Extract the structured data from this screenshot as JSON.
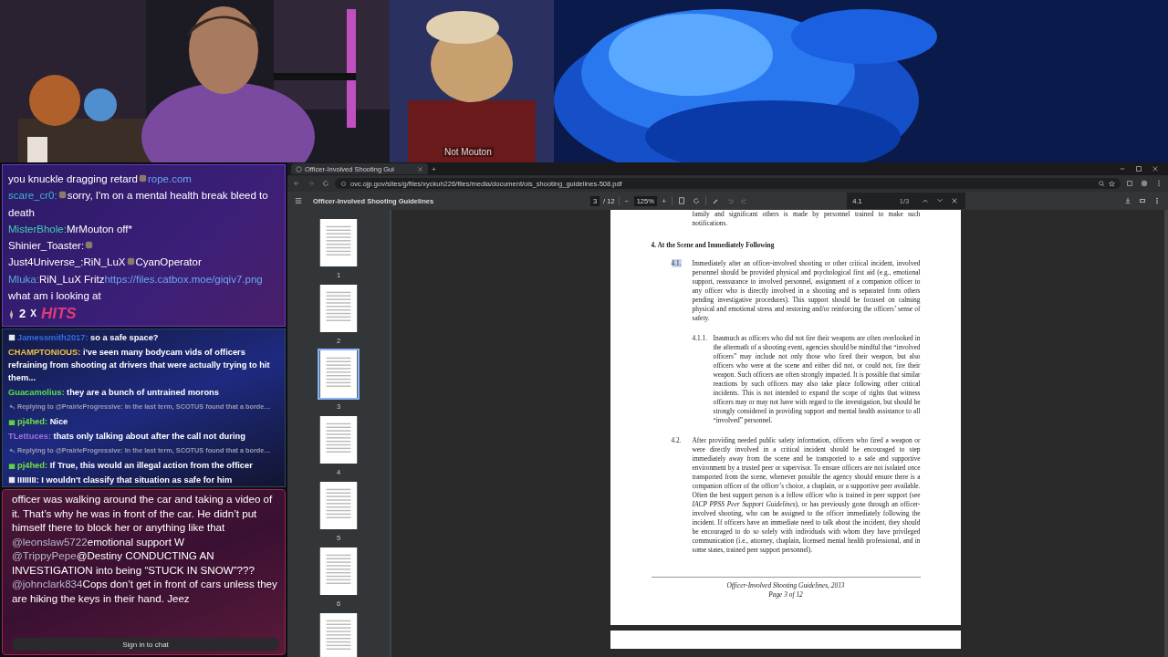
{
  "stream_overlay": {
    "caption": "Not Mouton"
  },
  "chat_top": {
    "messages": [
      {
        "parts": [
          {
            "kind": "text",
            "text": "you knuckle dragging retard"
          },
          {
            "kind": "emote"
          },
          {
            "kind": "link",
            "text": "rope.com"
          }
        ]
      },
      {
        "user": "scare_cr0:",
        "color": "#3fb8d0",
        "parts": [
          {
            "kind": "emote"
          },
          {
            "kind": "text",
            "text": "sorry, I'm on a mental health break bleed to death"
          }
        ]
      },
      {
        "user": "MisterBhole:",
        "color": "#3fd0b8",
        "parts": [
          {
            "kind": "text",
            "text": "MrMouton off*"
          }
        ]
      },
      {
        "user": "Shinier_Toaster:",
        "color": "#ffffff",
        "parts": [
          {
            "kind": "emote"
          }
        ]
      },
      {
        "user": "Just4Universe_:",
        "color": "#ffffff",
        "parts": [
          {
            "kind": "text",
            "text": "RiN_LuX"
          },
          {
            "kind": "emote"
          },
          {
            "kind": "text",
            "text": "CyanOperator"
          }
        ]
      },
      {
        "user": "Mluka:",
        "color": "#5aa8e0",
        "parts": [
          {
            "kind": "text",
            "text": "RiN_LuX Fritz"
          },
          {
            "kind": "link",
            "text": "https://files.catbox.moe/giqiv7.png"
          }
        ]
      },
      {
        "parts": [
          {
            "kind": "text",
            "text": "what am i looking at"
          }
        ]
      }
    ],
    "hits": {
      "count": "2",
      "times": "X",
      "label": "HITS"
    }
  },
  "chat_middle": {
    "messages": [
      {
        "kind": "message",
        "badge": {
          "kind": "emote"
        },
        "user": "Jamessmith2017:",
        "color": "#2f6fe0",
        "text": "so a safe space?"
      },
      {
        "kind": "message",
        "user": "CHAMPTONIOUS:",
        "color": "#f0c040",
        "text": "i've seen many bodycam vids of officers refraining from shooting at drivers that were actually trying to hit them..."
      },
      {
        "kind": "message",
        "user": "Guacamolius:",
        "color": "#58e050",
        "text": "they are a bunch of untrained morons"
      },
      {
        "kind": "reply",
        "text": "Replying to @PrairieProgressive: In the last term, SCOTUS found that a borde…"
      },
      {
        "kind": "message",
        "badge": {
          "kind": "gift"
        },
        "user": "pj4hed:",
        "color": "#70e040",
        "text": "Nice"
      },
      {
        "kind": "message",
        "user": "TLettuces:",
        "color": "#a070e8",
        "text": "thats only talking about after the call not during"
      },
      {
        "kind": "reply",
        "text": "Replying to @PrairieProgressive: In the last term, SCOTUS found that a borde…"
      },
      {
        "kind": "message",
        "badge": {
          "kind": "gift"
        },
        "user": "pj4hed:",
        "color": "#70e040",
        "text": "If True, this would an illegal action from the officer"
      },
      {
        "kind": "message",
        "badge": {
          "kind": "emote"
        },
        "user": "IIIIIIII:",
        "color": "#ffffff",
        "text": "I wouldn't classify that situation as safe for him"
      }
    ]
  },
  "chat_bottom": {
    "messages": [
      {
        "text": "officer was walking around the car and taking a video of it. That’s why he was in front of the car. He didn’t put himself there to block her or anything like that"
      },
      {
        "user": "@leonslaw5722",
        "text": "emotional support W"
      },
      {
        "user": "@TrippyPepe",
        "text": "@Destiny CONDUCTING AN INVESTIGATION into being “STUCK IN SNOW”???"
      },
      {
        "user": "@johnclark834",
        "text": "Cops don’t get in front of cars unless they are hiking the keys in their hand. Jeez"
      }
    ],
    "sign_in_button": "Sign in to chat"
  },
  "browser": {
    "tabs": [
      {
        "title": "Officer-Involved Shooting Gui",
        "selected": true
      }
    ],
    "new_tab": "+",
    "address": "ovc.ojp.gov/sites/g/files/xyckuh226/files/media/document/ois_shooting_guidelines-508.pdf",
    "pdf_toolbar": {
      "title": "Officer-Involved Shooting Guidelines",
      "page": "3",
      "page_total": "/ 12",
      "zoom_out": "−",
      "zoom": "125%",
      "zoom_in": "+"
    },
    "find": {
      "value": "4.1",
      "count": "1/3"
    }
  },
  "thumbnails": [
    {
      "label": "1",
      "selected": false
    },
    {
      "label": "2",
      "selected": false
    },
    {
      "label": "3",
      "selected": true
    },
    {
      "label": "4",
      "selected": false
    },
    {
      "label": "5",
      "selected": false
    },
    {
      "label": "6",
      "selected": false
    },
    {
      "selected": false
    }
  ],
  "pdf_page": {
    "blocks": [
      {
        "kind": "paragraph",
        "text": "family and significant others is made by personnel trained to make such notifications."
      },
      {
        "kind": "heading",
        "text": "4. At the Scene and Immediately Following"
      },
      {
        "kind": "item",
        "number": "4.1.",
        "highlighted": true,
        "text": "Immediately after an officer-involved shooting or other critical incident, involved personnel should be provided physical and psychological first aid (e.g., emotional support, reassurance to involved personnel, assignment of a companion officer to any officer who is directly involved in a shooting and is separated from others pending investigative procedures). This support should be focused on calming physical and emotional stress and restoring and/or reinforcing the officers’ sense of safety."
      },
      {
        "kind": "subitem",
        "number": "4.1.1.",
        "highlighted": false,
        "text": "Inasmuch as officers who did not fire their weapons are often overlooked in the aftermath of a shooting event, agencies should be mindful that “involved officers” may include not only those who fired their weapon, but also officers who were at the scene and either did not, or could not, fire their weapon.  Such officers are often strongly impacted. It is possible that similar reactions by such officers may also take place following other critical incidents.  This is not intended to expand the scope of rights that witness officers may or may not have with regard to the investigation, but should be strongly considered in providing support and mental health assistance to all “involved” personnel."
      },
      {
        "kind": "item",
        "number": "4.2.",
        "highlighted": false,
        "text": "After providing needed public safety information, officers who fired a weapon or were directly involved in a critical incident should be encouraged to step immediately away from the scene and be transported to a safe and supportive environment by a trusted peer or supervisor. To ensure officers are not isolated once transported from the scene, whenever possible the agency should ensure there is a companion officer of the officer’s choice, a chaplain, or a supportive peer available.  Often the best support person is a fellow officer who is trained in peer support (see *IACP PPSS Peer Support Guidelines*), or has previously gone through an officer-involved shooting, who can be assigned to the officer immediately following the incident. If officers have an immediate need to talk about the incident, they should be encouraged to do so solely with individuals with whom they have privileged communication (i.e., attorney, chaplain, licensed mental health professional, and in some states, trained peer support personnel)."
      }
    ],
    "footer": [
      "Officer-Involved Shooting Guidelines, 2013",
      "Page 3 of 12"
    ]
  }
}
